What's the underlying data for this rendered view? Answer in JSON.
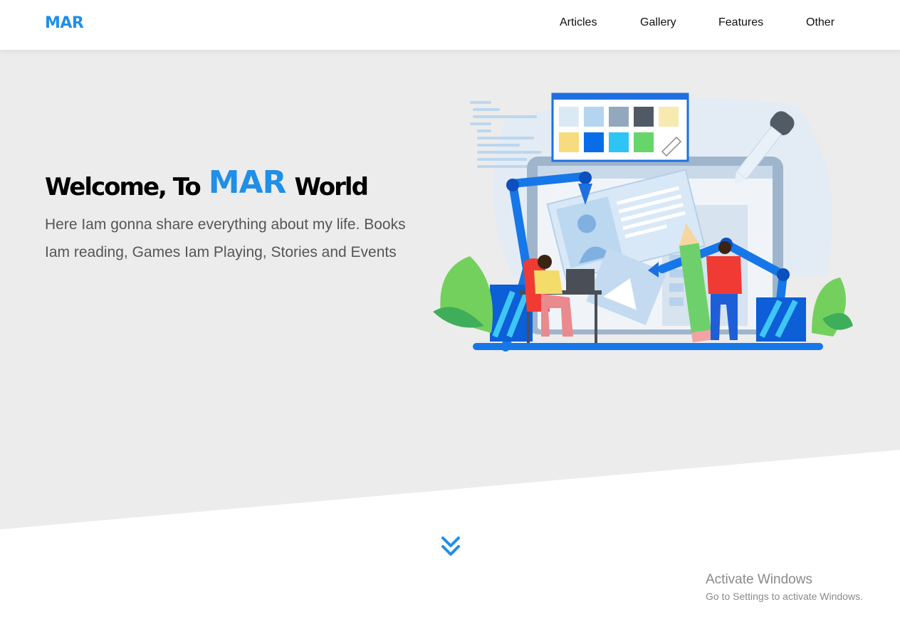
{
  "header": {
    "logo": "MAR",
    "nav": [
      {
        "label": "Articles"
      },
      {
        "label": "Gallery"
      },
      {
        "label": "Features"
      },
      {
        "label": "Other"
      }
    ]
  },
  "hero": {
    "title_prefix": "Welcome, To",
    "title_brand": "MAR",
    "title_suffix": "World",
    "description": "Here Iam gonna share everything about my life. Books Iam reading, Games Iam Playing, Stories and Events"
  },
  "icons": {
    "scroll_down": "double-chevron-down-icon"
  },
  "watermark": {
    "title": "Activate Windows",
    "subtitle": "Go to Settings to activate Windows."
  },
  "colors": {
    "accent": "#1f8fe8",
    "hero_bg": "#ececec",
    "text_dark": "#000000",
    "text_muted": "#555555"
  }
}
